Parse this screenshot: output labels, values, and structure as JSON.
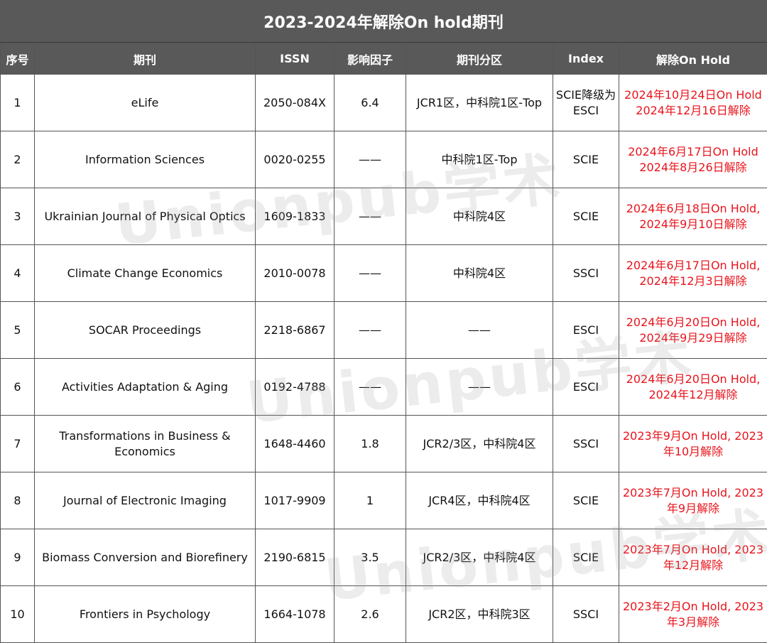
{
  "title": "2023-2024年解除On hold期刊",
  "headers": [
    "序号",
    "期刊",
    "ISSN",
    "影响因子",
    "期刊分区",
    "Index",
    "解除On Hold"
  ],
  "rows": [
    {
      "no": "1",
      "journal": "eLife",
      "issn": "2050-084X",
      "if": "6.4",
      "zone": "JCR1区，中科院1区-Top",
      "index": "SCIE降级为ESCI",
      "hold": "2024年10月24日On Hold 2024年12月16日解除"
    },
    {
      "no": "2",
      "journal": "Information Sciences",
      "issn": "0020-0255",
      "if": "——",
      "zone": "中科院1区-Top",
      "index": "SCIE",
      "hold": "2024年6月17日On Hold 2024年8月26日解除"
    },
    {
      "no": "3",
      "journal": "Ukrainian Journal of Physical Optics",
      "issn": "1609-1833",
      "if": "——",
      "zone": "中科院4区",
      "index": "SCIE",
      "hold": "2024年6月18日On Hold, 2024年9月10日解除"
    },
    {
      "no": "4",
      "journal": "Climate Change Economics",
      "issn": "2010-0078",
      "if": "——",
      "zone": "中科院4区",
      "index": "SSCI",
      "hold": "2024年6月17日On Hold, 2024年12月3日解除"
    },
    {
      "no": "5",
      "journal": "SOCAR Proceedings",
      "issn": "2218-6867",
      "if": "——",
      "zone": "——",
      "index": "ESCI",
      "hold": "2024年6月20日On Hold, 2024年9月29日解除"
    },
    {
      "no": "6",
      "journal": "Activities Adaptation & Aging",
      "issn": "0192-4788",
      "if": "——",
      "zone": "——",
      "index": "ESCI",
      "hold": "2024年6月20日On Hold, 2024年12月解除"
    },
    {
      "no": "7",
      "journal": "Transformations in Business & Economics",
      "issn": "1648-4460",
      "if": "1.8",
      "zone": "JCR2/3区，中科院4区",
      "index": "SSCI",
      "hold": "2023年9月On Hold, 2023年10月解除"
    },
    {
      "no": "8",
      "journal": "Journal of Electronic Imaging",
      "issn": "1017-9909",
      "if": "1",
      "zone": "JCR4区，中科院4区",
      "index": "SCIE",
      "hold": "2023年7月On Hold, 2023年9月解除"
    },
    {
      "no": "9",
      "journal": "Biomass Conversion and Biorefinery",
      "issn": "2190-6815",
      "if": "3.5",
      "zone": "JCR2/3区，中科院4区",
      "index": "SCIE",
      "hold": "2023年7月On Hold, 2023年12月解除"
    },
    {
      "no": "10",
      "journal": "Frontiers in Psychology",
      "issn": "1664-1078",
      "if": "2.6",
      "zone": "JCR2区，中科院3区",
      "index": "SSCI",
      "hold": "2023年2月On Hold, 2023年3月解除"
    }
  ],
  "watermark": "Unionpub学术",
  "colors": {
    "header_bg": "#595959",
    "hold_text": "#e8141c",
    "border": "#555555"
  }
}
